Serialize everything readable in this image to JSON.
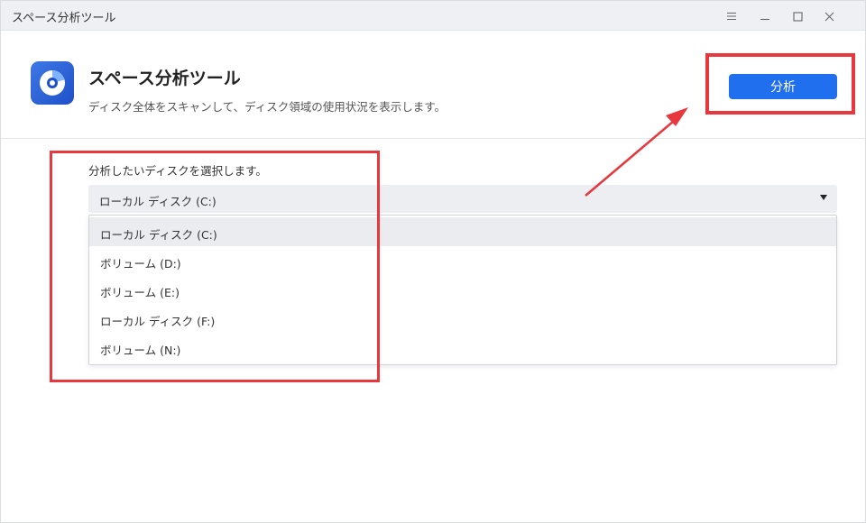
{
  "window": {
    "title": "スペース分析ツール",
    "controls": [
      "menu-icon",
      "minimize-icon",
      "maximize-icon",
      "close-icon"
    ]
  },
  "header": {
    "app_title": "スペース分析ツール",
    "description": "ディスク全体をスキャンして、ディスク領域の使用状況を表示します。",
    "analyze_label": "分析"
  },
  "disk_select": {
    "label": "分析したいディスクを選択します。",
    "selected": "ローカル ディスク (C:)",
    "options": [
      "ローカル ディスク (C:)",
      "ボリューム (D:)",
      "ボリューム (E:)",
      "ローカル ディスク (F:)",
      "ボリューム (N:)"
    ]
  },
  "colors": {
    "accent": "#1f6fef",
    "annotation": "#e8383d",
    "titlebar": "#eef0f3"
  }
}
